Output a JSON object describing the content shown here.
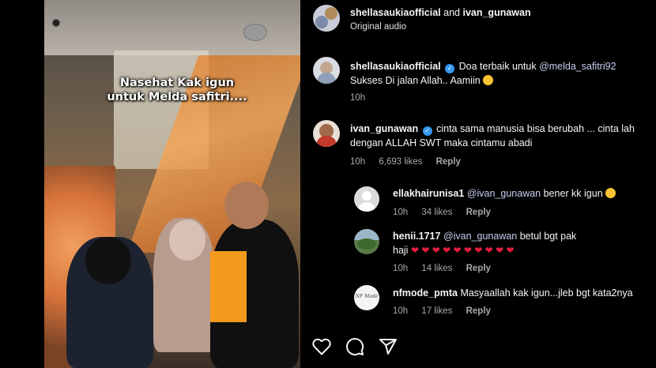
{
  "video": {
    "caption_line1": "Nasehat Kak igun",
    "caption_line2": "untuk Melda safitri...."
  },
  "post_header": {
    "author_primary": "shellasaukiaofficial",
    "connector": "and",
    "author_secondary": "ivan_gunawan",
    "audio": "Original audio"
  },
  "comments": [
    {
      "username": "shellasaukiaofficial",
      "text_prefix": "Doa terbaik untuk ",
      "mention": "@melda_safitri92",
      "text_line2": "Sukses Di jalan Allah.. Aamiin",
      "time": "10h"
    },
    {
      "username": "ivan_gunawan",
      "text_line1": "cinta sama manusia bisa berubah ... cinta lah",
      "text_line2": "dengan ALLAH SWT maka cintamu abadi",
      "time": "10h",
      "likes": "6,693 likes",
      "reply": "Reply"
    }
  ],
  "replies": [
    {
      "username": "ellakhairunisa1",
      "mention": "@ivan_gunawan",
      "text": " bener kk igun",
      "time": "10h",
      "likes": "34 likes",
      "reply": "Reply"
    },
    {
      "username": "henii.1717",
      "mention": "@ivan_gunawan",
      "text": " betul bgt pak",
      "text_line2": "haji",
      "time": "10h",
      "likes": "14 likes",
      "reply": "Reply"
    },
    {
      "username": "nfmode_pmta",
      "text": "Masyaallah kak igun...jleb bgt kata2nya",
      "avatar_text": "NF Mode",
      "time": "10h",
      "likes": "17 likes",
      "reply": "Reply"
    }
  ],
  "icons": [
    "heart-icon",
    "comment-icon",
    "share-icon",
    "verified-icon"
  ],
  "colors": {
    "background": "#000000",
    "mention": "#c6cff2",
    "verified": "#3897f0",
    "heart": "#e41e3f",
    "meta": "#a8a8a8"
  }
}
